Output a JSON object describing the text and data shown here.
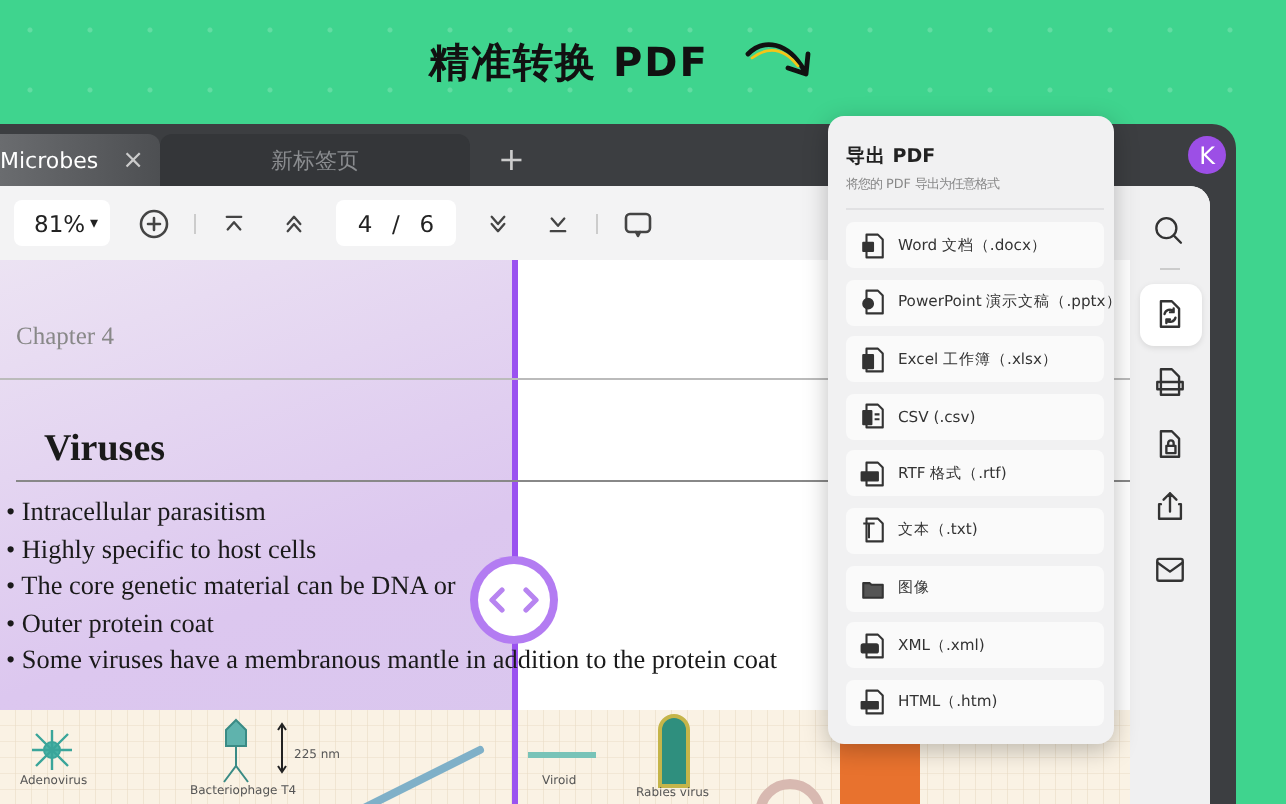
{
  "headline": {
    "text": "精准转换 PDF"
  },
  "tabs": [
    {
      "label": "Microbes",
      "selected": true,
      "close": "×"
    },
    {
      "label": "新标签页",
      "selected": false
    }
  ],
  "new_tab": "+",
  "avatar": "K",
  "toolbar": {
    "zoom": "81%",
    "zoom_caret": "▾",
    "page": "4",
    "page_separator": "/",
    "page_total": "6"
  },
  "document": {
    "chapter": "Chapter 4",
    "heading": "Viruses",
    "bullets": [
      "• Intracellular parasitism",
      "• Highly specific to host cells",
      "• The core genetic material can be DNA or",
      "• Outer protein coat",
      "• Some viruses have a membranous mantle in addition to the protein coat"
    ],
    "illustration_labels": [
      "Adenovirus",
      "Bacteriophage T4",
      "225 nm",
      "Viroid",
      "Rabies virus"
    ]
  },
  "export_panel": {
    "title": "导出 PDF",
    "subtitle": "将您的 PDF 导出为任意格式",
    "items": [
      {
        "kind": "word",
        "label": "Word 文档（.docx）"
      },
      {
        "kind": "ppt",
        "label": "PowerPoint 演示文稿（.pptx）"
      },
      {
        "kind": "excel",
        "label": "Excel 工作簿（.xlsx）"
      },
      {
        "kind": "csv",
        "label": "CSV (.csv)"
      },
      {
        "kind": "rtf",
        "label": "RTF 格式（.rtf)"
      },
      {
        "kind": "txt",
        "label": "文本（.txt)"
      },
      {
        "kind": "image",
        "label": "图像"
      },
      {
        "kind": "xml",
        "label": "XML（.xml)"
      },
      {
        "kind": "html",
        "label": "HTML（.htm)"
      }
    ]
  },
  "sidebar_tools": [
    {
      "kind": "search",
      "selected": false
    },
    {
      "kind": "convert",
      "selected": true
    },
    {
      "kind": "pdfa",
      "selected": false
    },
    {
      "kind": "protect",
      "selected": false
    },
    {
      "kind": "share",
      "selected": false
    },
    {
      "kind": "mail",
      "selected": false
    }
  ]
}
